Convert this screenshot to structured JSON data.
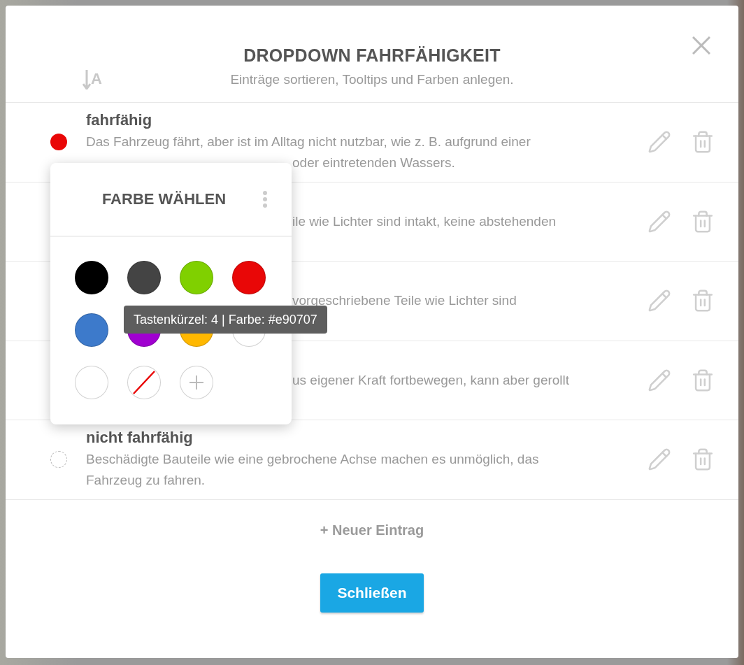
{
  "dialog": {
    "title": "DROPDOWN FAHRFÄHIGKEIT",
    "subtitle": "Einträge sortieren, Tooltips und Farben anlegen.",
    "sort_label": "A"
  },
  "entries": [
    {
      "kind": "full",
      "title": "fahrfähig",
      "color": "#e90707",
      "lines": [
        {
          "text": "Das Fahrzeug fährt, aber ist im Alltag nicht nutzbar, wie z. B. aufgrund einer",
          "covered": false
        },
        {
          "text": "oder eintretenden Wassers.",
          "covered": true
        }
      ]
    },
    {
      "kind": "covered",
      "lines": [
        {
          "text": "ile wie Lichter sind intakt, keine abstehenden",
          "covered": true
        }
      ]
    },
    {
      "kind": "covered",
      "lines": [
        {
          "text": "vorgeschriebene Teile wie Lichter sind",
          "covered": true
        }
      ]
    },
    {
      "kind": "covered",
      "lines": [
        {
          "text": "us eigener Kraft fortbewegen, kann aber gerollt",
          "covered": true
        }
      ]
    },
    {
      "kind": "full",
      "title": "nicht fahrfähig",
      "lines": [
        {
          "text": "Beschädigte Bauteile wie eine gebrochene Achse machen es unmöglich, das",
          "covered": false
        },
        {
          "text": "Fahrzeug zu fahren.",
          "covered": false
        }
      ]
    }
  ],
  "new_entry": "+ Neuer Eintrag",
  "close_button": "Schließen",
  "color_picker": {
    "title": "FARBE WÄHLEN",
    "swatches": [
      {
        "kind": "color",
        "color": "#000000"
      },
      {
        "kind": "color",
        "color": "#444444"
      },
      {
        "kind": "color",
        "color": "#80d000"
      },
      {
        "kind": "color",
        "color": "#e90707"
      },
      {
        "kind": "color",
        "color": "#3d7acb"
      },
      {
        "kind": "color",
        "color": "#a000d0"
      },
      {
        "kind": "color",
        "color": "#ffb800"
      },
      {
        "kind": "color",
        "color": "#ffffff"
      },
      {
        "kind": "color",
        "color": "#ffffff"
      },
      {
        "kind": "none"
      },
      {
        "kind": "add"
      }
    ]
  },
  "tooltip": "Tastenkürzel: 4 | Farbe: #e90707"
}
